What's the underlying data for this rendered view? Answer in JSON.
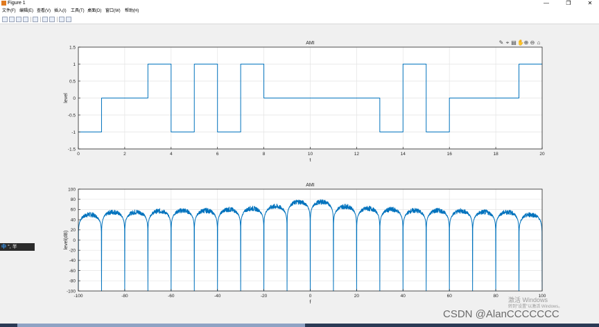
{
  "window": {
    "title": "Figure 1",
    "controls": {
      "minimize": "—",
      "maximize": "❐",
      "close": "✕"
    }
  },
  "menu": [
    "文件(F)",
    "编辑(E)",
    "查看(V)",
    "插入(I)",
    "工具(T)",
    "桌面(D)",
    "窗口(W)",
    "帮助(H)"
  ],
  "toolbar_icons": [
    "new-figure-icon",
    "open-file-icon",
    "save-icon",
    "print-icon",
    "link-plot-icon",
    "insert-colorbar-icon",
    "insert-legend-icon",
    "pointer-icon",
    "brush-icon"
  ],
  "axes_toolbar_icons": [
    "edit-plot-icon",
    "data-cursor-icon",
    "brush-data-icon",
    "pan-icon",
    "zoom-in-icon",
    "zoom-out-icon",
    "home-icon"
  ],
  "overlay": {
    "ime": {
      "lang": "中",
      "rest": "°, 半"
    },
    "watermark_line1": "激活 Windows",
    "watermark_line2": "转到\"设置\"以激活 Windows。",
    "csdn": "CSDN @AlanCCCCCCC"
  },
  "colors": {
    "line": "#0072BD",
    "grid": "#e3e3e3",
    "axes_bg": "#ffffff",
    "axis": "#262626"
  },
  "chart_data": [
    {
      "type": "line",
      "title": "AMI",
      "xlabel": "t",
      "ylabel": "level",
      "xlim": [
        0,
        20
      ],
      "ylim": [
        -1.5,
        1.5
      ],
      "xticks": [
        0,
        2,
        4,
        6,
        8,
        10,
        12,
        14,
        16,
        18,
        20
      ],
      "yticks": [
        -1.5,
        -1,
        -0.5,
        0,
        0.5,
        1,
        1.5
      ],
      "ytick_labels": [
        "-1.5",
        "-1",
        "-0.5",
        "0",
        "0.5",
        "1",
        "1.5"
      ],
      "grid": true,
      "step": true,
      "bit_period": 1,
      "levels": [
        -1,
        0,
        0,
        1,
        -1,
        1,
        -1,
        1,
        0,
        0,
        0,
        0,
        0,
        -1,
        1,
        -1,
        0,
        0,
        0,
        1
      ]
    },
    {
      "type": "line",
      "title": "AMI",
      "xlabel": "f",
      "ylabel": "level(dB)",
      "xlim": [
        -100,
        100
      ],
      "ylim": [
        -100,
        100
      ],
      "xticks": [
        -100,
        -80,
        -60,
        -40,
        -20,
        0,
        20,
        40,
        60,
        80,
        100
      ],
      "yticks": [
        -100,
        -80,
        -60,
        -40,
        -20,
        0,
        20,
        40,
        60,
        80,
        100
      ],
      "grid": true,
      "nulls_every": 10,
      "nulls_down_to": -100,
      "lobe_peaks": [
        {
          "f": -95,
          "db": 50
        },
        {
          "f": -85,
          "db": 55
        },
        {
          "f": -75,
          "db": 55
        },
        {
          "f": -65,
          "db": 57
        },
        {
          "f": -55,
          "db": 58
        },
        {
          "f": -45,
          "db": 58
        },
        {
          "f": -35,
          "db": 60
        },
        {
          "f": -25,
          "db": 62
        },
        {
          "f": -15,
          "db": 66
        },
        {
          "f": -5,
          "db": 75
        },
        {
          "f": 5,
          "db": 75
        },
        {
          "f": 15,
          "db": 66
        },
        {
          "f": 25,
          "db": 62
        },
        {
          "f": 35,
          "db": 60
        },
        {
          "f": 45,
          "db": 58
        },
        {
          "f": 55,
          "db": 58
        },
        {
          "f": 65,
          "db": 57
        },
        {
          "f": 75,
          "db": 55
        },
        {
          "f": 85,
          "db": 55
        },
        {
          "f": 95,
          "db": 50
        }
      ]
    }
  ]
}
